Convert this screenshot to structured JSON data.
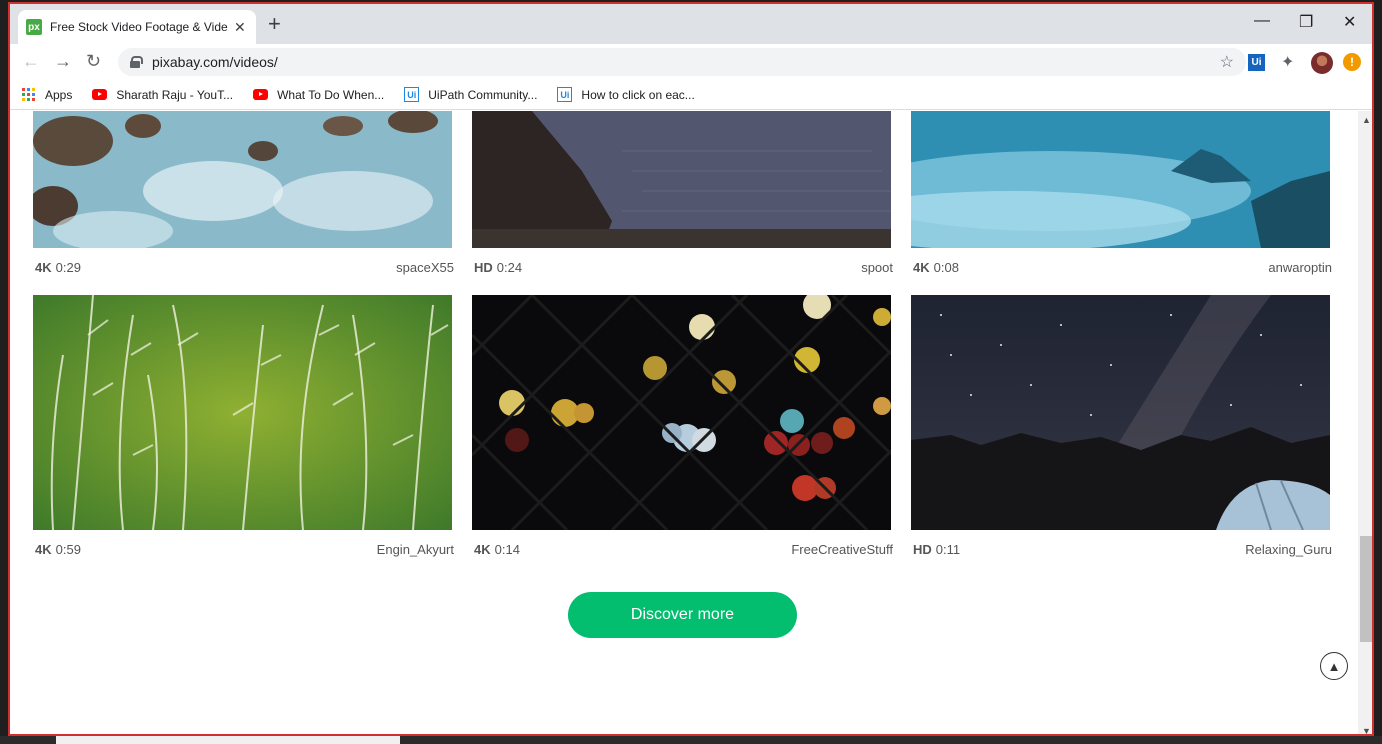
{
  "browser": {
    "tab_title": "Free Stock Video Footage & Vide",
    "tab_icon": "px",
    "url": "pixabay.com/videos/"
  },
  "bookmarks": [
    {
      "label": "Apps",
      "icon": "apps-grid-icon"
    },
    {
      "label": "Sharath Raju - YouT...",
      "icon": "youtube-icon"
    },
    {
      "label": "What To Do When...",
      "icon": "youtube-icon"
    },
    {
      "label": "UiPath Community...",
      "icon": "uipath-icon"
    },
    {
      "label": "How to click on eac...",
      "icon": "uipath-icon"
    }
  ],
  "extensions": {
    "uipath": "Ui",
    "alert": "!"
  },
  "videos": [
    {
      "quality": "4K",
      "duration": "0:29",
      "author": "spaceX55"
    },
    {
      "quality": "HD",
      "duration": "0:24",
      "author": "spoot"
    },
    {
      "quality": "4K",
      "duration": "0:08",
      "author": "anwaroptin"
    },
    {
      "quality": "4K",
      "duration": "0:59",
      "author": "Engin_Akyurt"
    },
    {
      "quality": "4K",
      "duration": "0:14",
      "author": "FreeCreativeStuff"
    },
    {
      "quality": "HD",
      "duration": "0:11",
      "author": "Relaxing_Guru"
    }
  ],
  "discover_label": "Discover more",
  "colors": {
    "accent": "#02be6e",
    "frame": "#d32f2f"
  }
}
